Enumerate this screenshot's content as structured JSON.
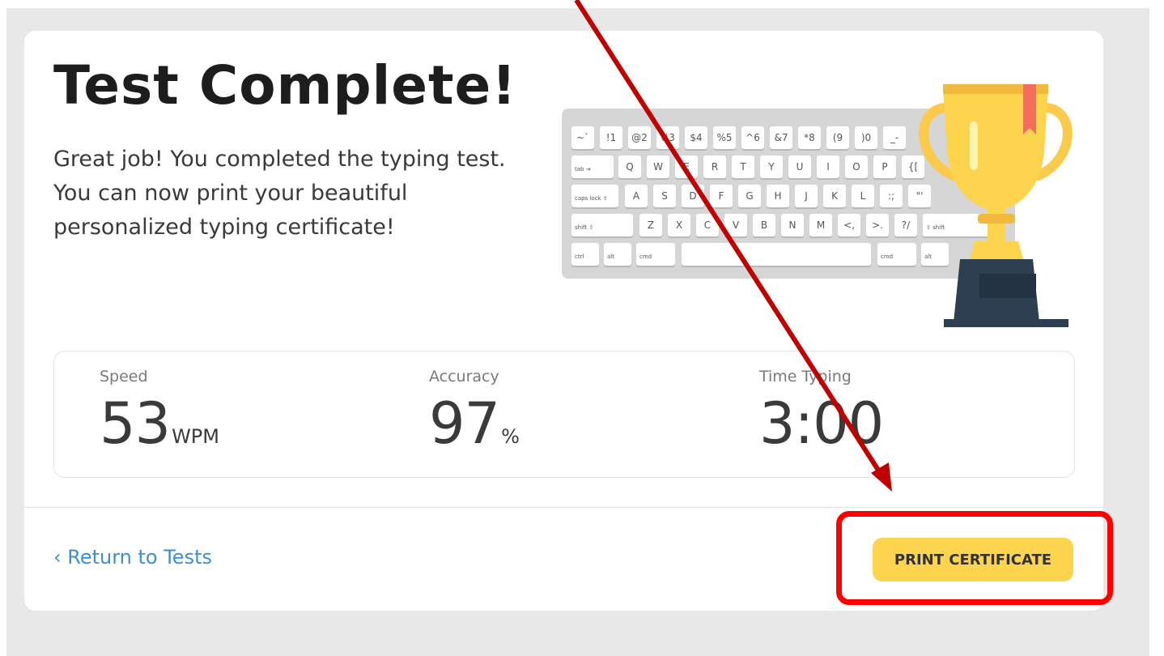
{
  "header": {
    "title": "Test Complete!",
    "message": "Great job! You completed the typing test. You can now print your beautiful personalized typing certificate!"
  },
  "stats": [
    {
      "label": "Speed",
      "value": "53",
      "unit": "WPM"
    },
    {
      "label": "Accuracy",
      "value": "97",
      "unit": "%"
    },
    {
      "label": "Time Typing",
      "value": "3:00",
      "unit": ""
    }
  ],
  "footer": {
    "return_label": "‹ Return to Tests",
    "print_label": "PRINT CERTIFICATE"
  },
  "keyboard": {
    "row1": [
      "~`",
      "!1",
      "@2",
      "#3",
      "$4",
      "%5",
      "^6",
      "&7",
      "*8",
      "(9",
      ")0",
      "_-"
    ],
    "row2_lead": "tab ⇥",
    "row2": [
      "Q",
      "W",
      "E",
      "R",
      "T",
      "Y",
      "U",
      "I",
      "O",
      "P",
      "{["
    ],
    "row3_lead": "caps lock ⇪",
    "row3": [
      "A",
      "S",
      "D",
      "F",
      "G",
      "H",
      "J",
      "K",
      "L",
      ":;",
      "\"'"
    ],
    "row4_lead": "shift ⇧",
    "row4": [
      "Z",
      "X",
      "C",
      "V",
      "B",
      "N",
      "M",
      "<,",
      ">.",
      "?/"
    ],
    "row4_tail": "⇧ shift",
    "row5": [
      "ctrl",
      "alt",
      "cmd",
      "cmd",
      "alt"
    ]
  },
  "colors": {
    "accent_yellow": "#fcd44e",
    "link_blue": "#3d8ed3",
    "annotation_red": "#ff0000",
    "arrow_red": "#c00000",
    "trophy_gold": "#fbc94b",
    "trophy_base": "#2f3f52"
  }
}
